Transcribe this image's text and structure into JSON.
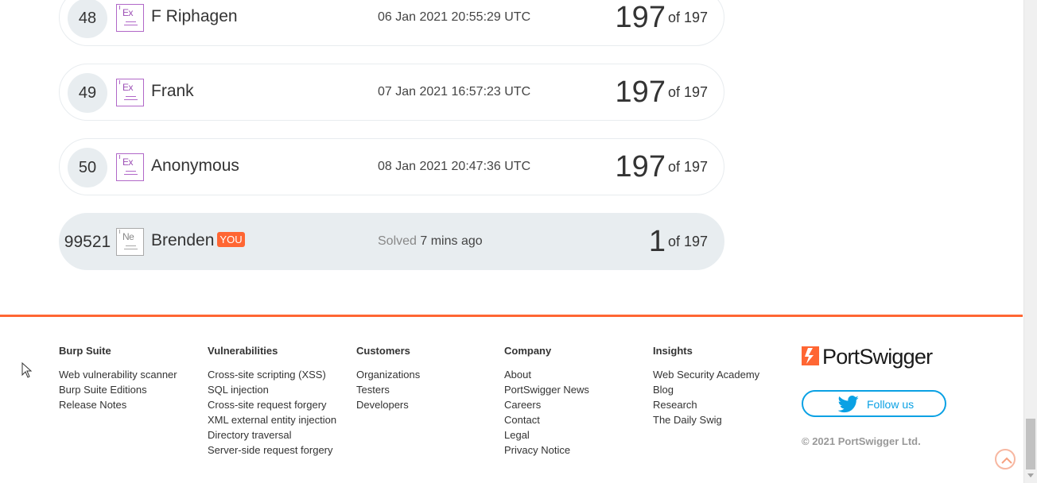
{
  "leaderboard": {
    "rows": [
      {
        "rank": "48",
        "badge": "Ex",
        "name": "F Riphagen",
        "date": "06 Jan 2021 20:55:29 UTC",
        "score": "197",
        "of_label": "of 197"
      },
      {
        "rank": "49",
        "badge": "Ex",
        "name": "Frank",
        "date": "07 Jan 2021 16:57:23 UTC",
        "score": "197",
        "of_label": "of 197"
      },
      {
        "rank": "50",
        "badge": "Ex",
        "name": "Anonymous",
        "date": "08 Jan 2021 20:47:36 UTC",
        "score": "197",
        "of_label": "of 197"
      }
    ],
    "you_row": {
      "rank": "99521",
      "badge": "Ne",
      "name": "Brenden",
      "you_tag": "YOU",
      "solved_prefix": "Solved",
      "solved_time": "7 mins ago",
      "score": "1",
      "of_label": "of 197"
    }
  },
  "footer": {
    "columns": [
      {
        "title": "Burp Suite",
        "links": [
          "Web vulnerability scanner",
          "Burp Suite Editions",
          "Release Notes"
        ]
      },
      {
        "title": "Vulnerabilities",
        "links": [
          "Cross-site scripting (XSS)",
          "SQL injection",
          "Cross-site request forgery",
          "XML external entity injection",
          "Directory traversal",
          "Server-side request forgery"
        ]
      },
      {
        "title": "Customers",
        "links": [
          "Organizations",
          "Testers",
          "Developers"
        ]
      },
      {
        "title": "Company",
        "links": [
          "About",
          "PortSwigger News",
          "Careers",
          "Contact",
          "Legal",
          "Privacy Notice"
        ]
      },
      {
        "title": "Insights",
        "links": [
          "Web Security Academy",
          "Blog",
          "Research",
          "The Daily Swig"
        ]
      }
    ],
    "logo_text": "PortSwigger",
    "follow_label": "Follow us",
    "copyright": "© 2021 PortSwigger Ltd."
  },
  "colors": {
    "accent": "#ff6633",
    "expert_badge": "#b168c8",
    "twitter": "#0aa1e4"
  }
}
